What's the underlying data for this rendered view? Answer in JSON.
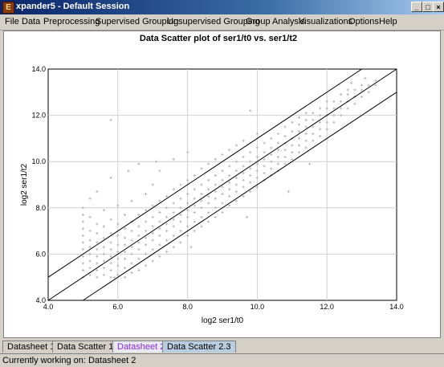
{
  "window": {
    "title": "xpander5 - Default Session",
    "app_icon": "E",
    "controls": [
      "_",
      "□",
      "×"
    ]
  },
  "menu": [
    "File",
    "Data",
    "Preprocessing",
    "Supervised Grouping",
    "Unsupervised Grouping",
    "Group Analysis",
    "Visualizations",
    "Options",
    "Help"
  ],
  "tabs": [
    {
      "label": "Datasheet 1",
      "state": "normal"
    },
    {
      "label": "Data Scatter 1.1",
      "state": "normal"
    },
    {
      "label": "Datasheet 2",
      "state": "active"
    },
    {
      "label": "Data Scatter 2.3",
      "state": "focused"
    }
  ],
  "status": {
    "text": "Currently working on: Datasheet 2"
  },
  "chart_data": {
    "type": "scatter",
    "title": "Data Scatter plot of ser1/t0 vs. ser1/t2",
    "xlabel": "log2 ser1/t0",
    "ylabel": "log2 ser1/t2",
    "xlim": [
      4.0,
      14.0
    ],
    "ylim": [
      4.0,
      14.0
    ],
    "x_ticks": [
      "4.0",
      "6.0",
      "8.0",
      "10.0",
      "12.0",
      "14.0"
    ],
    "y_ticks": [
      "4.0",
      "6.0",
      "8.0",
      "10.0",
      "12.0",
      "14.0"
    ],
    "grid": true,
    "point_color": "#b8b8b8",
    "reference_lines": [
      {
        "label": "y = x + 1",
        "points": [
          [
            4.0,
            5.0
          ],
          [
            13.0,
            14.0
          ]
        ]
      },
      {
        "label": "y = x",
        "points": [
          [
            4.0,
            4.0
          ],
          [
            14.0,
            14.0
          ]
        ]
      },
      {
        "label": "y = x - 1",
        "points": [
          [
            5.0,
            4.0
          ],
          [
            14.0,
            13.0
          ]
        ]
      }
    ],
    "points": [
      [
        5.0,
        5.0
      ],
      [
        5.0,
        5.3
      ],
      [
        5.0,
        5.6
      ],
      [
        5.0,
        5.9
      ],
      [
        5.0,
        6.2
      ],
      [
        5.0,
        6.5
      ],
      [
        5.0,
        6.8
      ],
      [
        5.0,
        7.1
      ],
      [
        5.0,
        7.4
      ],
      [
        5.0,
        7.7
      ],
      [
        5.0,
        8.0
      ],
      [
        5.2,
        5.1
      ],
      [
        5.2,
        5.4
      ],
      [
        5.2,
        5.7
      ],
      [
        5.2,
        6.0
      ],
      [
        5.2,
        6.3
      ],
      [
        5.2,
        6.6
      ],
      [
        5.2,
        7.0
      ],
      [
        5.2,
        7.6
      ],
      [
        5.2,
        8.4
      ],
      [
        5.4,
        5.0
      ],
      [
        5.4,
        5.3
      ],
      [
        5.4,
        5.6
      ],
      [
        5.4,
        5.9
      ],
      [
        5.4,
        6.2
      ],
      [
        5.4,
        6.5
      ],
      [
        5.4,
        6.9
      ],
      [
        5.4,
        7.3
      ],
      [
        5.4,
        8.7
      ],
      [
        5.6,
        5.1
      ],
      [
        5.6,
        5.4
      ],
      [
        5.6,
        5.7
      ],
      [
        5.6,
        6.0
      ],
      [
        5.6,
        6.3
      ],
      [
        5.6,
        6.7
      ],
      [
        5.6,
        7.2
      ],
      [
        5.6,
        7.9
      ],
      [
        5.8,
        5.0
      ],
      [
        5.8,
        5.3
      ],
      [
        5.8,
        5.6
      ],
      [
        5.8,
        5.9
      ],
      [
        5.8,
        6.2
      ],
      [
        5.8,
        6.5
      ],
      [
        5.8,
        6.9
      ],
      [
        5.8,
        7.5
      ],
      [
        5.8,
        9.3
      ],
      [
        6.0,
        5.1
      ],
      [
        6.0,
        5.5
      ],
      [
        6.0,
        5.8
      ],
      [
        6.0,
        6.1
      ],
      [
        6.0,
        6.4
      ],
      [
        6.0,
        6.8
      ],
      [
        6.0,
        7.3
      ],
      [
        6.0,
        8.1
      ],
      [
        6.2,
        5.0
      ],
      [
        6.2,
        5.4
      ],
      [
        6.2,
        5.8
      ],
      [
        6.2,
        6.1
      ],
      [
        6.2,
        6.4
      ],
      [
        6.2,
        6.7
      ],
      [
        6.2,
        7.1
      ],
      [
        6.2,
        7.7
      ],
      [
        6.4,
        5.2
      ],
      [
        6.4,
        5.6
      ],
      [
        6.4,
        6.0
      ],
      [
        6.4,
        6.3
      ],
      [
        6.4,
        6.6
      ],
      [
        6.4,
        7.0
      ],
      [
        6.4,
        7.4
      ],
      [
        6.4,
        8.3
      ],
      [
        6.6,
        5.3
      ],
      [
        6.6,
        5.8
      ],
      [
        6.6,
        6.2
      ],
      [
        6.6,
        6.5
      ],
      [
        6.6,
        6.8
      ],
      [
        6.6,
        7.2
      ],
      [
        6.6,
        7.7
      ],
      [
        6.6,
        9.9
      ],
      [
        6.8,
        5.5
      ],
      [
        6.8,
        6.0
      ],
      [
        6.8,
        6.4
      ],
      [
        6.8,
        6.7
      ],
      [
        6.8,
        7.0
      ],
      [
        6.8,
        7.4
      ],
      [
        6.8,
        7.9
      ],
      [
        6.8,
        8.6
      ],
      [
        7.0,
        5.7
      ],
      [
        7.0,
        6.2
      ],
      [
        7.0,
        6.6
      ],
      [
        7.0,
        6.9
      ],
      [
        7.0,
        7.2
      ],
      [
        7.0,
        7.6
      ],
      [
        7.0,
        8.1
      ],
      [
        7.0,
        9.0
      ],
      [
        7.2,
        5.9
      ],
      [
        7.2,
        6.4
      ],
      [
        7.2,
        6.8
      ],
      [
        7.2,
        7.1
      ],
      [
        7.2,
        7.4
      ],
      [
        7.2,
        7.8
      ],
      [
        7.2,
        8.3
      ],
      [
        7.2,
        9.6
      ],
      [
        7.4,
        6.1
      ],
      [
        7.4,
        6.6
      ],
      [
        7.4,
        7.0
      ],
      [
        7.4,
        7.3
      ],
      [
        7.4,
        7.6
      ],
      [
        7.4,
        8.0
      ],
      [
        7.4,
        8.5
      ],
      [
        7.6,
        6.3
      ],
      [
        7.6,
        6.8
      ],
      [
        7.6,
        7.2
      ],
      [
        7.6,
        7.5
      ],
      [
        7.6,
        7.8
      ],
      [
        7.6,
        8.2
      ],
      [
        7.6,
        8.8
      ],
      [
        7.6,
        10.1
      ],
      [
        7.8,
        6.5
      ],
      [
        7.8,
        7.0
      ],
      [
        7.8,
        7.4
      ],
      [
        7.8,
        7.7
      ],
      [
        7.8,
        8.0
      ],
      [
        7.8,
        8.4
      ],
      [
        7.8,
        9.0
      ],
      [
        8.0,
        6.8
      ],
      [
        8.0,
        7.2
      ],
      [
        8.0,
        7.6
      ],
      [
        8.0,
        7.9
      ],
      [
        8.0,
        8.2
      ],
      [
        8.0,
        8.6
      ],
      [
        8.0,
        9.2
      ],
      [
        8.0,
        10.4
      ],
      [
        8.2,
        7.0
      ],
      [
        8.2,
        7.4
      ],
      [
        8.2,
        7.8
      ],
      [
        8.2,
        8.1
      ],
      [
        8.2,
        8.4
      ],
      [
        8.2,
        8.8
      ],
      [
        8.2,
        9.4
      ],
      [
        8.4,
        7.2
      ],
      [
        8.4,
        7.6
      ],
      [
        8.4,
        8.0
      ],
      [
        8.4,
        8.3
      ],
      [
        8.4,
        8.6
      ],
      [
        8.4,
        9.0
      ],
      [
        8.4,
        9.7
      ],
      [
        8.6,
        7.4
      ],
      [
        8.6,
        7.8
      ],
      [
        8.6,
        8.2
      ],
      [
        8.6,
        8.5
      ],
      [
        8.6,
        8.8
      ],
      [
        8.6,
        9.2
      ],
      [
        8.6,
        9.9
      ],
      [
        8.8,
        7.6
      ],
      [
        8.8,
        8.0
      ],
      [
        8.8,
        8.4
      ],
      [
        8.8,
        8.7
      ],
      [
        8.8,
        9.0
      ],
      [
        8.8,
        9.4
      ],
      [
        8.8,
        10.1
      ],
      [
        9.0,
        7.8
      ],
      [
        9.0,
        8.2
      ],
      [
        9.0,
        8.6
      ],
      [
        9.0,
        8.9
      ],
      [
        9.0,
        9.2
      ],
      [
        9.0,
        9.6
      ],
      [
        9.0,
        10.3
      ],
      [
        9.2,
        8.1
      ],
      [
        9.2,
        8.5
      ],
      [
        9.2,
        8.8
      ],
      [
        9.2,
        9.1
      ],
      [
        9.2,
        9.4
      ],
      [
        9.2,
        9.8
      ],
      [
        9.2,
        10.5
      ],
      [
        9.4,
        8.3
      ],
      [
        9.4,
        8.7
      ],
      [
        9.4,
        9.0
      ],
      [
        9.4,
        9.3
      ],
      [
        9.4,
        9.6
      ],
      [
        9.4,
        10.0
      ],
      [
        9.4,
        10.7
      ],
      [
        9.6,
        8.5
      ],
      [
        9.6,
        8.9
      ],
      [
        9.6,
        9.2
      ],
      [
        9.6,
        9.5
      ],
      [
        9.6,
        9.8
      ],
      [
        9.6,
        10.2
      ],
      [
        9.6,
        10.9
      ],
      [
        9.8,
        8.7
      ],
      [
        9.8,
        9.1
      ],
      [
        9.8,
        9.4
      ],
      [
        9.8,
        9.7
      ],
      [
        9.8,
        10.0
      ],
      [
        9.8,
        10.4
      ],
      [
        10.0,
        8.9
      ],
      [
        10.0,
        9.3
      ],
      [
        10.0,
        9.6
      ],
      [
        10.0,
        9.9
      ],
      [
        10.0,
        10.2
      ],
      [
        10.0,
        10.6
      ],
      [
        10.0,
        11.2
      ],
      [
        10.2,
        9.2
      ],
      [
        10.2,
        9.5
      ],
      [
        10.2,
        9.8
      ],
      [
        10.2,
        10.1
      ],
      [
        10.2,
        10.4
      ],
      [
        10.2,
        10.8
      ],
      [
        10.4,
        9.4
      ],
      [
        10.4,
        9.7
      ],
      [
        10.4,
        10.0
      ],
      [
        10.4,
        10.3
      ],
      [
        10.4,
        10.6
      ],
      [
        10.4,
        11.0
      ],
      [
        10.6,
        9.6
      ],
      [
        10.6,
        9.9
      ],
      [
        10.6,
        10.2
      ],
      [
        10.6,
        10.5
      ],
      [
        10.6,
        10.8
      ],
      [
        10.6,
        11.2
      ],
      [
        10.8,
        9.9
      ],
      [
        10.8,
        10.2
      ],
      [
        10.8,
        10.5
      ],
      [
        10.8,
        10.8
      ],
      [
        10.8,
        11.1
      ],
      [
        10.8,
        11.5
      ],
      [
        11.0,
        10.1
      ],
      [
        11.0,
        10.4
      ],
      [
        11.0,
        10.7
      ],
      [
        11.0,
        11.0
      ],
      [
        11.0,
        11.3
      ],
      [
        11.0,
        11.7
      ],
      [
        11.2,
        10.4
      ],
      [
        11.2,
        10.7
      ],
      [
        11.2,
        11.0
      ],
      [
        11.2,
        11.3
      ],
      [
        11.2,
        11.6
      ],
      [
        11.2,
        11.9
      ],
      [
        11.4,
        10.6
      ],
      [
        11.4,
        10.9
      ],
      [
        11.4,
        11.2
      ],
      [
        11.4,
        11.5
      ],
      [
        11.4,
        11.8
      ],
      [
        11.4,
        12.1
      ],
      [
        11.6,
        10.9
      ],
      [
        11.6,
        11.2
      ],
      [
        11.6,
        11.5
      ],
      [
        11.6,
        11.8
      ],
      [
        11.6,
        12.1
      ],
      [
        11.8,
        11.1
      ],
      [
        11.8,
        11.4
      ],
      [
        11.8,
        11.7
      ],
      [
        11.8,
        12.0
      ],
      [
        11.8,
        12.3
      ],
      [
        12.0,
        11.4
      ],
      [
        12.0,
        11.7
      ],
      [
        12.0,
        12.0
      ],
      [
        12.0,
        12.3
      ],
      [
        12.0,
        12.6
      ],
      [
        12.2,
        11.7
      ],
      [
        12.2,
        12.0
      ],
      [
        12.2,
        12.3
      ],
      [
        12.2,
        12.6
      ],
      [
        12.4,
        12.0
      ],
      [
        12.4,
        12.3
      ],
      [
        12.4,
        12.6
      ],
      [
        12.4,
        12.9
      ],
      [
        12.6,
        12.3
      ],
      [
        12.6,
        12.6
      ],
      [
        12.6,
        12.9
      ],
      [
        12.6,
        13.1
      ],
      [
        12.8,
        12.5
      ],
      [
        12.8,
        12.8
      ],
      [
        12.8,
        13.1
      ],
      [
        13.0,
        12.8
      ],
      [
        13.0,
        13.1
      ],
      [
        13.0,
        13.3
      ],
      [
        13.2,
        13.0
      ],
      [
        13.2,
        13.3
      ],
      [
        13.4,
        13.3
      ],
      [
        13.4,
        13.5
      ],
      [
        13.1,
        13.6
      ],
      [
        12.7,
        13.4
      ],
      [
        6.3,
        9.6
      ],
      [
        7.1,
        10.0
      ],
      [
        5.8,
        11.8
      ],
      [
        9.8,
        12.2
      ],
      [
        10.9,
        8.7
      ],
      [
        9.7,
        7.6
      ],
      [
        8.1,
        6.3
      ],
      [
        5.9,
        5.0
      ],
      [
        11.5,
        9.9
      ]
    ]
  }
}
